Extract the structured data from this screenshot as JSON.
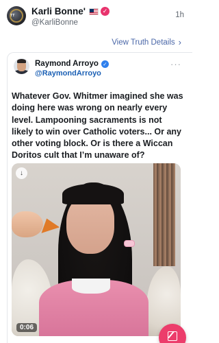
{
  "top_post": {
    "display_name": "Karli Bonne'",
    "handle": "@KarliBonne",
    "timestamp": "1h",
    "avatar_text": "TT",
    "view_details": "View Truth Details",
    "icons": {
      "flag": "us-flag-icon",
      "verified": "verified-badge-icon",
      "chevron": "chevron-right-icon"
    },
    "colors": {
      "verified_pink": "#e8336d",
      "link_blue": "#4a67a8"
    }
  },
  "quoted_post": {
    "display_name": "Raymond Arroyo",
    "handle": "@RaymondArroyo",
    "more": "···",
    "text": "Whatever Gov. Whitmer imagined she was doing here was wrong on nearly every level. Lampooning sacraments is not likely to win over Catholic voters... Or any other voting block. Or is there a Wiccan Doritos cult that I’m unaware of?",
    "media": {
      "type": "video",
      "duration": "0:06",
      "icons": {
        "download": "download-icon"
      }
    },
    "colors": {
      "verified_blue": "#2f80ed",
      "handle_blue": "#1a5fb4"
    }
  },
  "fab": {
    "icon": "compose-icon",
    "color": "#ec3d6b"
  }
}
